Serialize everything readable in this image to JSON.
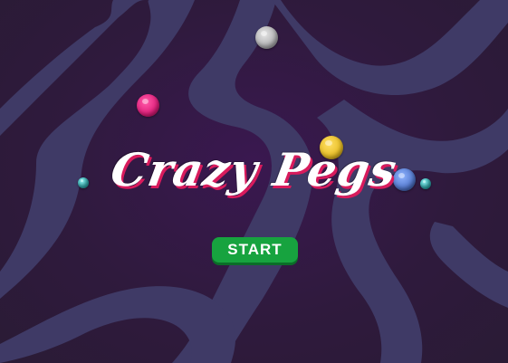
{
  "game": {
    "title": "Crazy Pegs",
    "start_label": "START"
  },
  "colors": {
    "background": "#2c1b38",
    "wave": "#3f3a66",
    "title_shadow": "#d81b5c",
    "start_button": "#17a33f"
  },
  "pegs": [
    {
      "name": "gray-peg",
      "color": "#a8a8aa"
    },
    {
      "name": "pink-peg",
      "color": "#e01c7a"
    },
    {
      "name": "yellow-peg",
      "color": "#e6bb21"
    },
    {
      "name": "blue-peg",
      "color": "#4f74c9"
    },
    {
      "name": "teal-peg-left",
      "color": "#2aa6aa"
    },
    {
      "name": "teal-peg-right",
      "color": "#2aa6aa"
    }
  ]
}
